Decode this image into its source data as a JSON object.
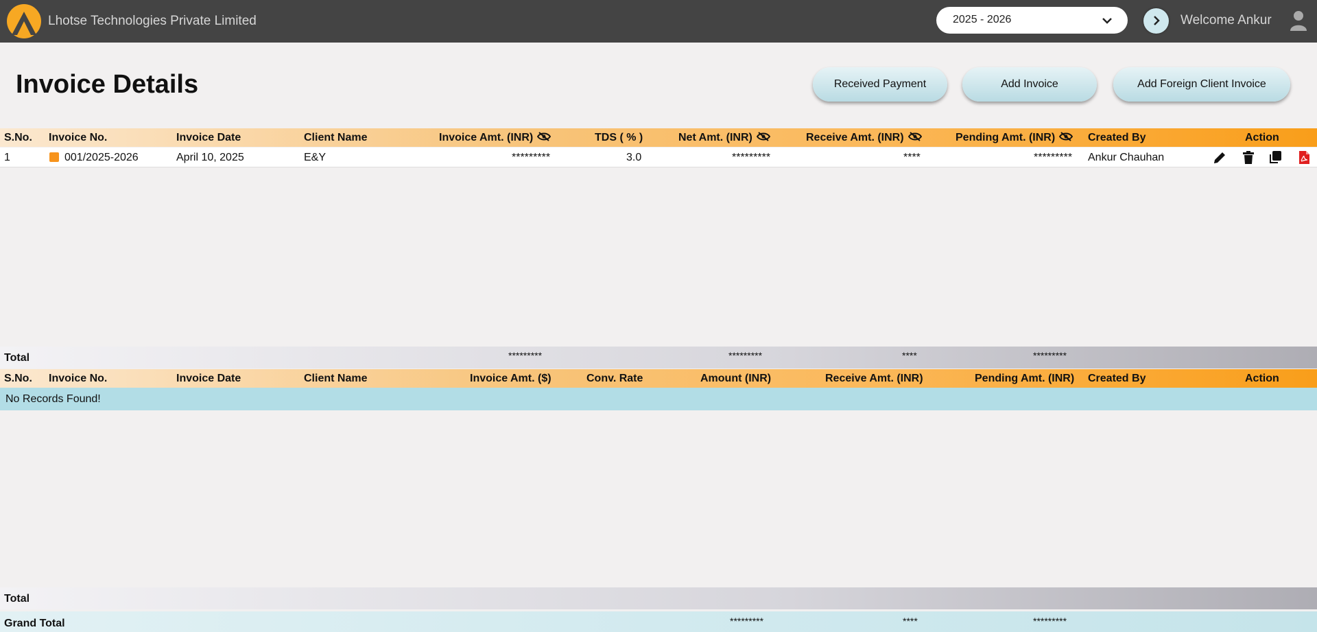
{
  "header": {
    "company_name": "Lhotse Technologies Private Limited",
    "financial_year": "2025 - 2026",
    "welcome_text": "Welcome Ankur"
  },
  "page": {
    "title": "Invoice Details",
    "buttons": {
      "received_payment": "Received Payment",
      "add_invoice": "Add Invoice",
      "add_foreign_invoice": "Add Foreign Client Invoice"
    }
  },
  "domestic_table": {
    "columns": {
      "sno": "S.No.",
      "invoice_no": "Invoice No.",
      "invoice_date": "Invoice Date",
      "client_name": "Client Name",
      "invoice_amt": "Invoice Amt. (INR)",
      "tds": "TDS ( % )",
      "net_amt": "Net Amt. (INR)",
      "receive_amt": "Receive Amt. (INR)",
      "pending_amt": "Pending Amt. (INR)",
      "created_by": "Created By",
      "action": "Action"
    },
    "rows": [
      {
        "sno": "1",
        "invoice_no": "001/2025-2026",
        "status_color": "#f7941d",
        "invoice_date": "April 10, 2025",
        "client_name": "E&Y",
        "invoice_amt": "*********",
        "tds": "3.0",
        "net_amt": "*********",
        "receive_amt": "****",
        "pending_amt": "*********",
        "created_by": "Ankur Chauhan",
        "actions": [
          "pencil-icon",
          "trash-icon",
          "copy-icon",
          "pdf-icon"
        ]
      }
    ],
    "total": {
      "label": "Total",
      "invoice_amt": "*********",
      "net_amt": "*********",
      "receive_amt": "****",
      "pending_amt": "*********"
    }
  },
  "foreign_table": {
    "columns": {
      "sno": "S.No.",
      "invoice_no": "Invoice No.",
      "invoice_date": "Invoice Date",
      "client_name": "Client Name",
      "invoice_amt": "Invoice Amt. ($)",
      "conv_rate": "Conv. Rate",
      "amount": "Amount (INR)",
      "receive_amt": "Receive Amt. (INR)",
      "pending_amt": "Pending Amt. (INR)",
      "created_by": "Created By",
      "action": "Action"
    },
    "empty_message": "No Records Found!",
    "total": {
      "label": "Total"
    }
  },
  "grand_total": {
    "label": "Grand Total",
    "net_amt": "*********",
    "receive_amt": "****",
    "pending_amt": "*********"
  },
  "colors": {
    "header_bg": "#444444",
    "accent_orange": "#f99e1a",
    "no_records_bg": "#b2dde6",
    "pdf_red": "#e02020"
  }
}
